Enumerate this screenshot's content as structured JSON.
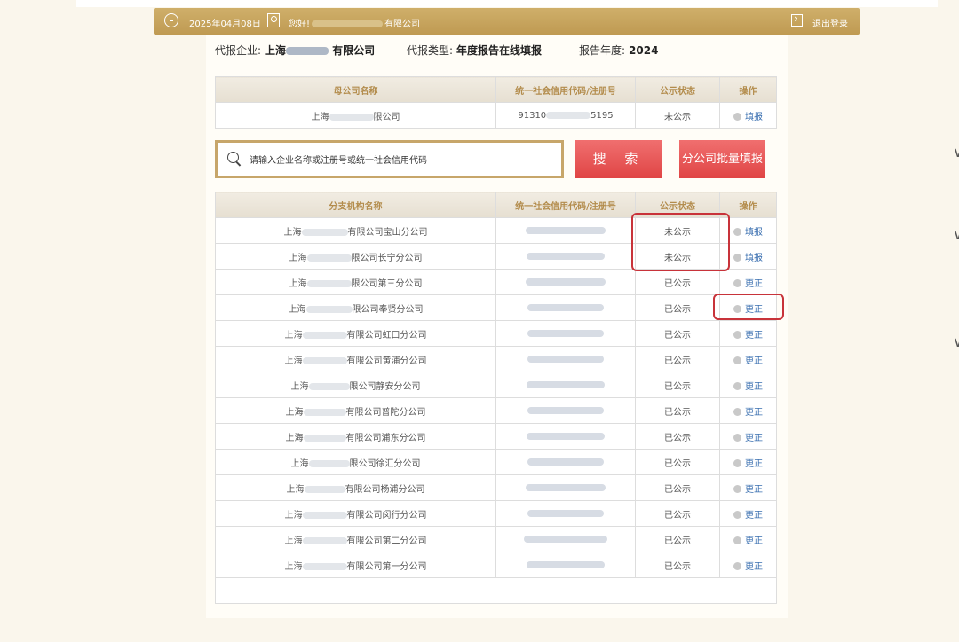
{
  "header": {
    "date": "2025年04月08日",
    "greeting_prefix": "您好!",
    "greeting_suffix": "有限公司",
    "logout": "退出登录"
  },
  "info": {
    "company_label": "代报企业:",
    "company_prefix": "上海",
    "company_suffix": "有限公司",
    "type_label": "代报类型:",
    "type_value": "年度报告在线填报",
    "year_label": "报告年度:",
    "year_value": "2024"
  },
  "parent_table": {
    "headers": [
      "母公司名称",
      "统一社会信用代码/注册号",
      "公示状态",
      "操作"
    ],
    "row": {
      "name_prefix": "上海",
      "name_suffix": "限公司",
      "code_prefix": "91310",
      "code_suffix": "5195",
      "status": "未公示",
      "action": "填报"
    }
  },
  "search": {
    "placeholder": "请输入企业名称或注册号或统一社会信用代码",
    "search_button": "搜 索",
    "batch_button": "分公司批量填报"
  },
  "branch_table": {
    "headers": [
      "分支机构名称",
      "统一社会信用代码/注册号",
      "公示状态",
      "操作"
    ],
    "rows": [
      {
        "prefix": "上海",
        "suffix": "有限公司宝山分公司",
        "status": "未公示",
        "action": "填报"
      },
      {
        "prefix": "上海",
        "suffix": "限公司长宁分公司",
        "status": "未公示",
        "action": "填报"
      },
      {
        "prefix": "上海",
        "suffix": "限公司第三分公司",
        "status": "已公示",
        "action": "更正"
      },
      {
        "prefix": "上海",
        "suffix": "限公司奉贤分公司",
        "status": "已公示",
        "action": "更正"
      },
      {
        "prefix": "上海",
        "suffix": "有限公司虹口分公司",
        "status": "已公示",
        "action": "更正"
      },
      {
        "prefix": "上海",
        "suffix": "有限公司黄浦分公司",
        "status": "已公示",
        "action": "更正"
      },
      {
        "prefix": "上海",
        "suffix": "限公司静安分公司",
        "status": "已公示",
        "action": "更正"
      },
      {
        "prefix": "上海",
        "suffix": "有限公司普陀分公司",
        "status": "已公示",
        "action": "更正"
      },
      {
        "prefix": "上海",
        "suffix": "有限公司浦东分公司",
        "status": "已公示",
        "action": "更正"
      },
      {
        "prefix": "上海",
        "suffix": "限公司徐汇分公司",
        "status": "已公示",
        "action": "更正"
      },
      {
        "prefix": "上海",
        "suffix": "有限公司杨浦分公司",
        "status": "已公示",
        "action": "更正"
      },
      {
        "prefix": "上海",
        "suffix": "有限公司闵行分公司",
        "status": "已公示",
        "action": "更正"
      },
      {
        "prefix": "上海",
        "suffix": "有限公司第二分公司",
        "status": "已公示",
        "action": "更正"
      },
      {
        "prefix": "上海",
        "suffix": "有限公司第一分公司",
        "status": "已公示",
        "action": "更正"
      }
    ]
  },
  "colors": {
    "accent_gold": "#c7a66a",
    "button_red": "#e04545",
    "highlight_red": "#c8333a",
    "link_blue": "#3a6fb0"
  }
}
